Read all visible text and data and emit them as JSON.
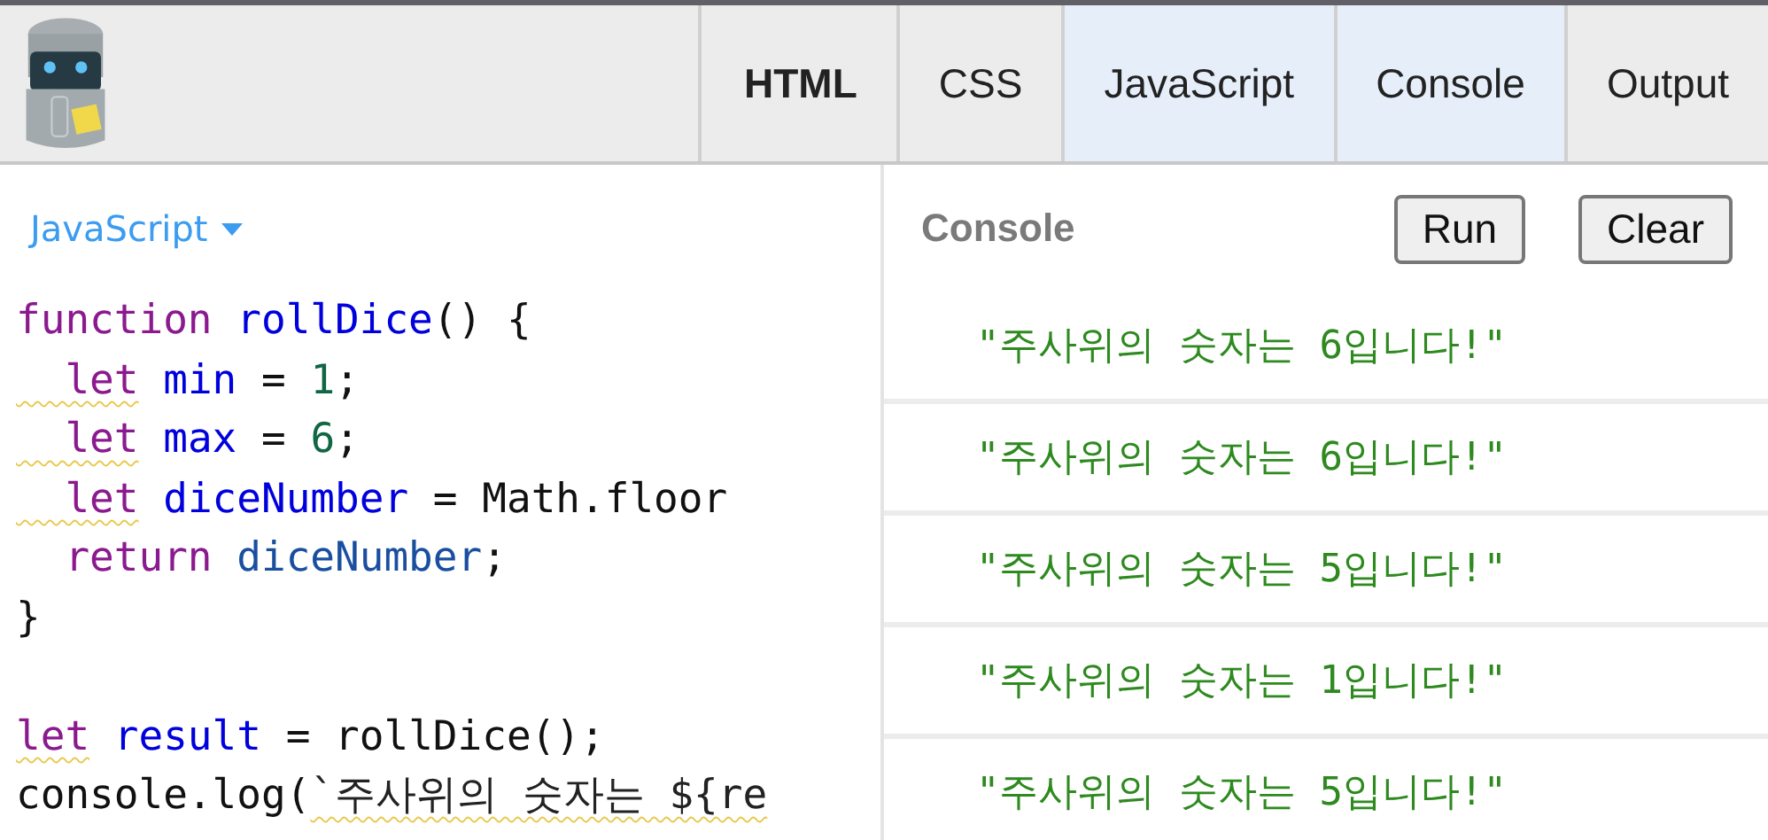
{
  "tabs": [
    {
      "label": "HTML",
      "selected": false,
      "bold": true
    },
    {
      "label": "CSS",
      "selected": false,
      "bold": false
    },
    {
      "label": "JavaScript",
      "selected": true,
      "bold": false
    },
    {
      "label": "Console",
      "selected": true,
      "bold": false
    },
    {
      "label": "Output",
      "selected": false,
      "bold": false
    }
  ],
  "editor": {
    "language": "JavaScript",
    "lines": [
      {
        "kind": "code",
        "tokens": [
          {
            "kind": "keyword",
            "text": "function"
          },
          {
            "kind": "def",
            "text": " rollDice"
          },
          {
            "kind": "plain",
            "text": "() {"
          }
        ]
      },
      {
        "kind": "code",
        "tokens": [
          {
            "kind": "keyword",
            "text": "  let",
            "warning": true
          },
          {
            "kind": "def",
            "text": " min"
          },
          {
            "kind": "plain",
            "text": " = "
          },
          {
            "kind": "number",
            "text": "1"
          },
          {
            "kind": "plain",
            "text": ";"
          }
        ]
      },
      {
        "kind": "code",
        "tokens": [
          {
            "kind": "keyword",
            "text": "  let",
            "warning": true
          },
          {
            "kind": "def",
            "text": " max"
          },
          {
            "kind": "plain",
            "text": " = "
          },
          {
            "kind": "number",
            "text": "6"
          },
          {
            "kind": "plain",
            "text": ";"
          }
        ]
      },
      {
        "kind": "code",
        "tokens": [
          {
            "kind": "keyword",
            "text": "  let",
            "warning": true
          },
          {
            "kind": "def",
            "text": " diceNumber"
          },
          {
            "kind": "plain",
            "text": " = Math.floor"
          }
        ]
      },
      {
        "kind": "code",
        "tokens": [
          {
            "kind": "keyword",
            "text": "  return"
          },
          {
            "kind": "variable",
            "text": " diceNumber"
          },
          {
            "kind": "plain",
            "text": ";"
          }
        ]
      },
      {
        "kind": "code",
        "tokens": [
          {
            "kind": "plain",
            "text": "}"
          }
        ]
      },
      {
        "kind": "blank"
      },
      {
        "kind": "code",
        "tokens": [
          {
            "kind": "keyword",
            "text": "let",
            "warning": true
          },
          {
            "kind": "def",
            "text": " result"
          },
          {
            "kind": "plain",
            "text": " = rollDice();"
          }
        ]
      },
      {
        "kind": "code",
        "tokens": [
          {
            "kind": "plain",
            "text": "console.log("
          },
          {
            "kind": "string",
            "text": "`주사위의 숫자는 ${re",
            "warning": true
          }
        ]
      }
    ]
  },
  "console": {
    "title": "Console",
    "buttons": [
      "Run",
      "Clear"
    ],
    "entries": [
      "\"주사위의 숫자는 6입니다!\"",
      "\"주사위의 숫자는 6입니다!\"",
      "\"주사위의 숫자는 5입니다!\"",
      "\"주사위의 숫자는 1입니다!\"",
      "\"주사위의 숫자는 5입니다!\""
    ]
  }
}
